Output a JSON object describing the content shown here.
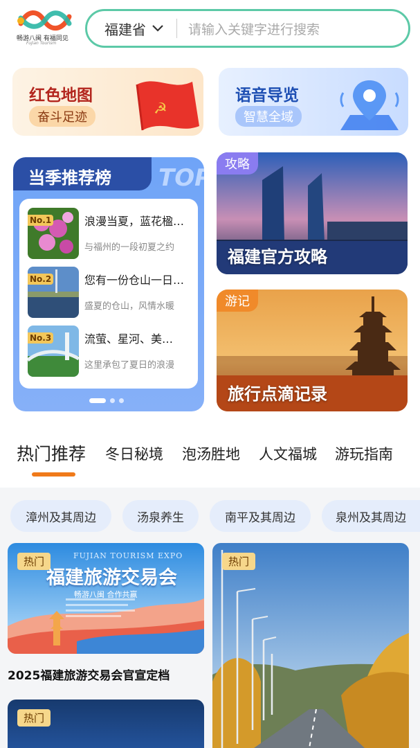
{
  "header": {
    "logo_text": "畅游八闽 有福同见",
    "logo_subtext": "Fujian Tourism",
    "region": "福建省",
    "search_placeholder": "请输入关键字进行搜索"
  },
  "quick_cards": [
    {
      "title": "红色地图",
      "subtitle": "奋斗足迹"
    },
    {
      "title": "语音导览",
      "subtitle": "智慧全域"
    }
  ],
  "ranking": {
    "title": "当季推荐榜",
    "badge": "TOP",
    "items": [
      {
        "no": "No.1",
        "title": "浪漫当夏，蓝花楹…",
        "desc": "与福州的一段初夏之约"
      },
      {
        "no": "No.2",
        "title": "您有一份仓山一日…",
        "desc": "盛夏的仓山，风情水暖"
      },
      {
        "no": "No.3",
        "title": "流萤、星河、美…",
        "desc": "这里承包了夏日的浪漫"
      }
    ]
  },
  "photo_cards": [
    {
      "tag": "攻略",
      "title": "福建官方攻略"
    },
    {
      "tag": "游记",
      "title": "旅行点滴记录"
    }
  ],
  "tabs": [
    "热门推荐",
    "冬日秘境",
    "泡汤胜地",
    "人文福城",
    "游玩指南"
  ],
  "chips": [
    "漳州及其周边",
    "汤泉养生",
    "南平及其周边",
    "泉州及其周边"
  ],
  "feed": [
    {
      "tag": "热门",
      "title": "2025福建旅游交易会官宣定档",
      "poster_title": "福建旅游交易会",
      "poster_en": "FUJIAN TOURISM EXPO",
      "poster_sub": "畅游八闽  合作共赢"
    },
    {
      "tag": "热门"
    },
    {
      "tag": "热门"
    }
  ],
  "colors": {
    "accent": "#f07a1a",
    "search_border": "#5cc9a7",
    "rank_head": "#2b4fa6",
    "red_title": "#b3261e",
    "blue_title": "#1e4fb3"
  }
}
